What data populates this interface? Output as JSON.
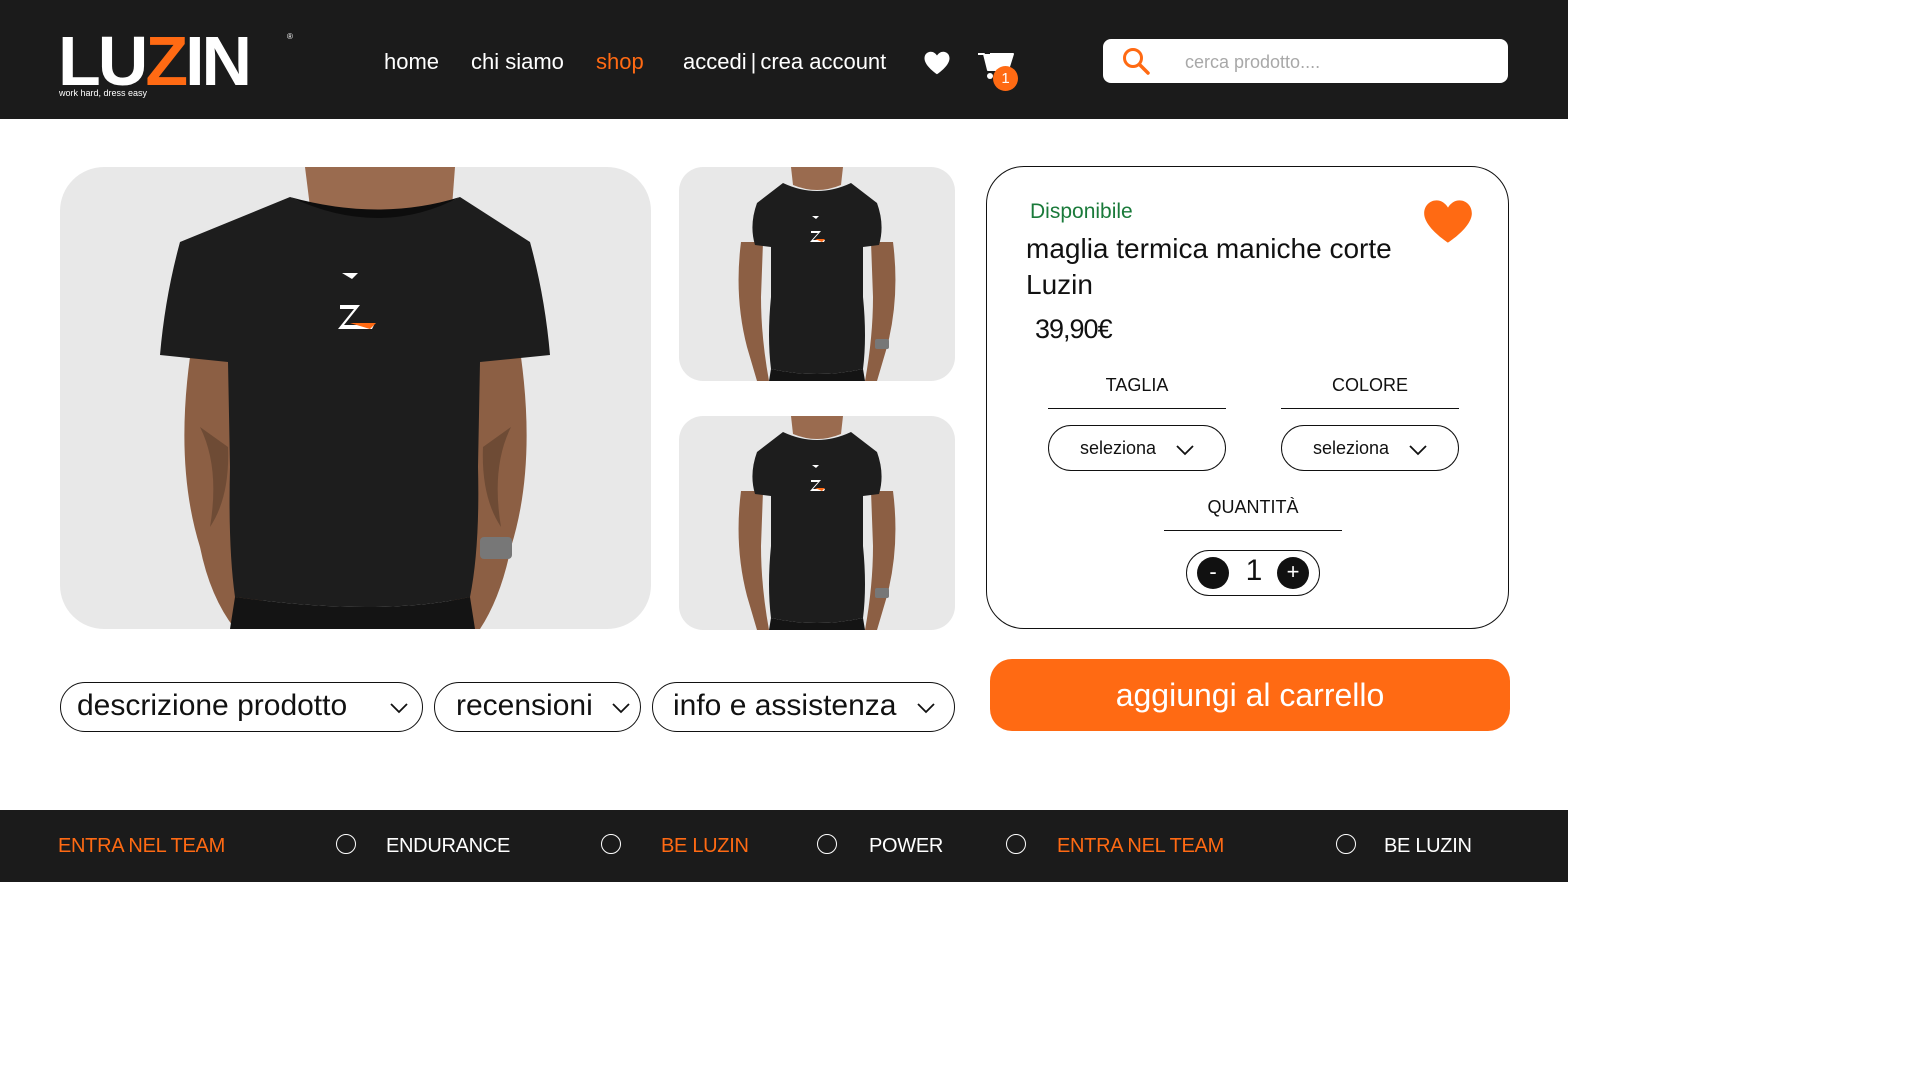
{
  "header": {
    "logo_text": "LUZIN",
    "logo_tagline": "work hard, dress easy",
    "logo_reg": "®",
    "nav": [
      {
        "label": "home",
        "active": false
      },
      {
        "label": "chi siamo",
        "active": false
      },
      {
        "label": "shop",
        "active": true
      }
    ],
    "login_label": "accedi",
    "login_sep": "|",
    "register_label": "crea account",
    "wishlist_icon": "heart-icon",
    "cart_icon": "cart-icon",
    "cart_count": "1",
    "search": {
      "placeholder": "cerca prodotto....",
      "icon": "search-icon"
    }
  },
  "gallery": {
    "images": [
      "main-product-photo",
      "thumbnail-front",
      "thumbnail-side"
    ]
  },
  "product": {
    "availability": "Disponibile",
    "name": "maglia termica maniche corte Luzin",
    "price": "39,90€",
    "size_label": "TAGLIA",
    "size_value": "seleziona",
    "color_label": "COLORE",
    "color_value": "seleziona",
    "quantity_label": "QUANTITÀ",
    "quantity": "1",
    "minus": "-",
    "plus": "+",
    "add_to_cart": "aggiungi al carrello"
  },
  "accordions": [
    {
      "label": "descrizione prodotto"
    },
    {
      "label": "recensioni"
    },
    {
      "label": "info e assistenza"
    }
  ],
  "footer": {
    "items": [
      {
        "label": "ENTRA NEL TEAM",
        "color": "orange"
      },
      {
        "label": "ENDURANCE",
        "color": "white"
      },
      {
        "label": "BE LUZIN",
        "color": "orange"
      },
      {
        "label": "POWER",
        "color": "white"
      },
      {
        "label": "ENTRA NEL TEAM",
        "color": "orange"
      },
      {
        "label": "BE LUZIN",
        "color": "white"
      }
    ]
  },
  "colors": {
    "accent": "#ff6a13",
    "header_bg": "#1b1b1b",
    "available": "#1a7a3a"
  }
}
